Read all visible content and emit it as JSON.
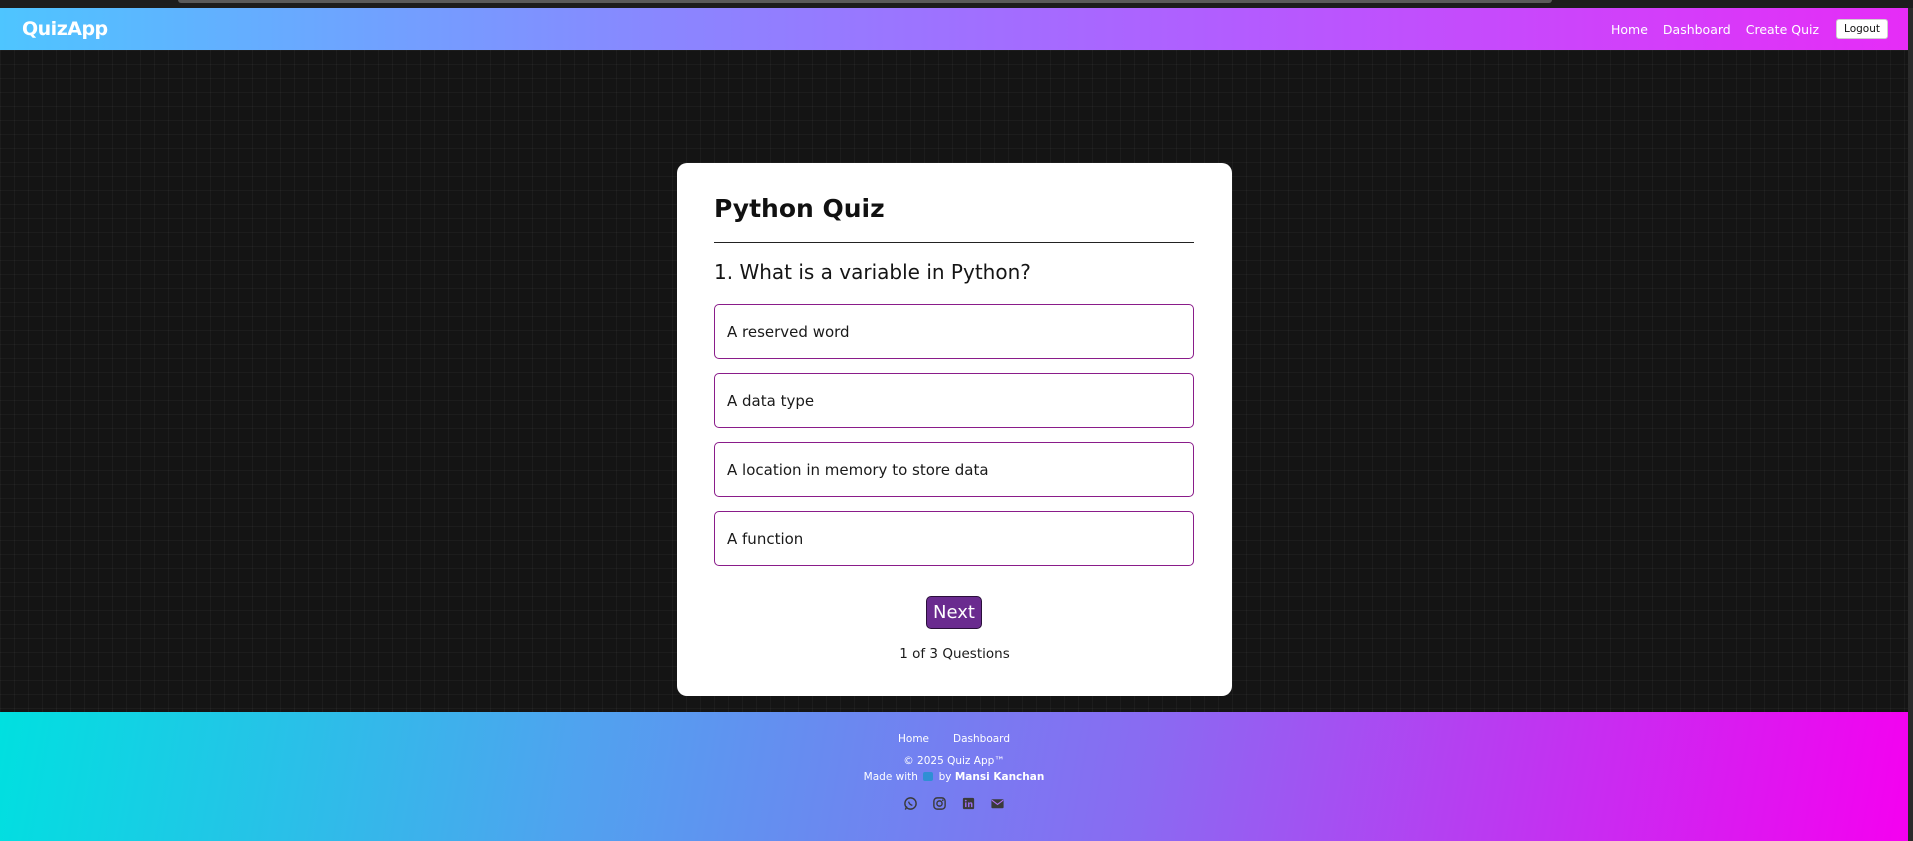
{
  "navbar": {
    "brand": "QuizApp",
    "links": [
      "Home",
      "Dashboard",
      "Create Quiz"
    ],
    "logout_label": "Logout"
  },
  "quiz": {
    "title": "Python Quiz",
    "question": "1. What is a variable in Python?",
    "options": [
      "A reserved word",
      "A data type",
      "A location in memory to store data",
      "A function"
    ],
    "next_label": "Next",
    "progress_text": "1 of 3 Questions"
  },
  "footer": {
    "links": [
      "Home",
      "Dashboard"
    ],
    "copyright": "© 2025 Quiz App™",
    "made_with_prefix": "Made with",
    "made_with_by": "by",
    "author": "Mansi Kanchan",
    "social_icons": [
      "whatsapp-icon",
      "instagram-icon",
      "linkedin-icon",
      "mail-icon"
    ]
  },
  "colors": {
    "option_border": "#8a1c8a",
    "next_button": "#6a2b8f",
    "social_icon": "#3a3a3a"
  }
}
